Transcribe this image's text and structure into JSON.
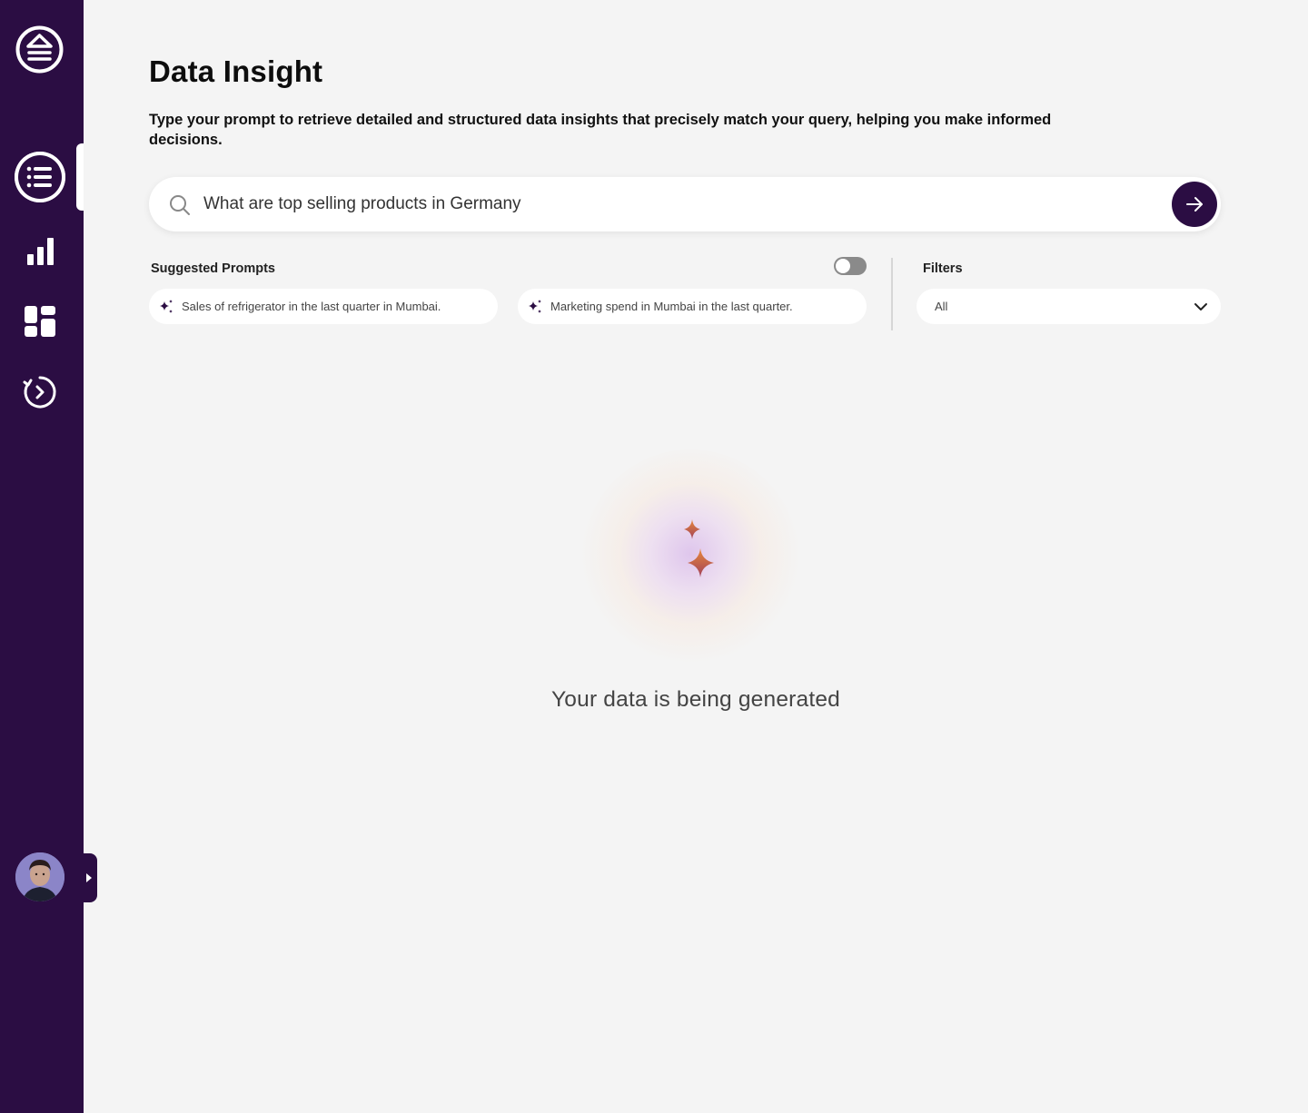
{
  "sidebar": {
    "logo_icon": "eject-logo-icon",
    "items": [
      {
        "name": "list",
        "icon": "list-icon",
        "active": true
      },
      {
        "name": "chart",
        "icon": "bar-chart-icon",
        "active": false
      },
      {
        "name": "dashboard",
        "icon": "dashboard-grid-icon",
        "active": false
      },
      {
        "name": "history",
        "icon": "history-icon",
        "active": false
      }
    ],
    "avatar": "user-avatar"
  },
  "header": {
    "title": "Data Insight",
    "description": "Type your prompt to retrieve detailed and structured data insights that precisely match your query, helping you make informed decisions."
  },
  "search": {
    "value": "What are top selling products in Germany"
  },
  "suggested": {
    "label": "Suggested Prompts",
    "toggle_on": false,
    "chips": [
      "Sales of refrigerator in the last quarter in Mumbai.",
      "Marketing spend in Mumbai in the last quarter."
    ]
  },
  "filters": {
    "label": "Filters",
    "selected": "All"
  },
  "status": {
    "message": "Your data is being generated"
  },
  "colors": {
    "sidebar_bg": "#2b0d43",
    "page_bg": "#f4f4f4",
    "accent": "#2b0d43",
    "star_orange": "#e07a3a"
  }
}
